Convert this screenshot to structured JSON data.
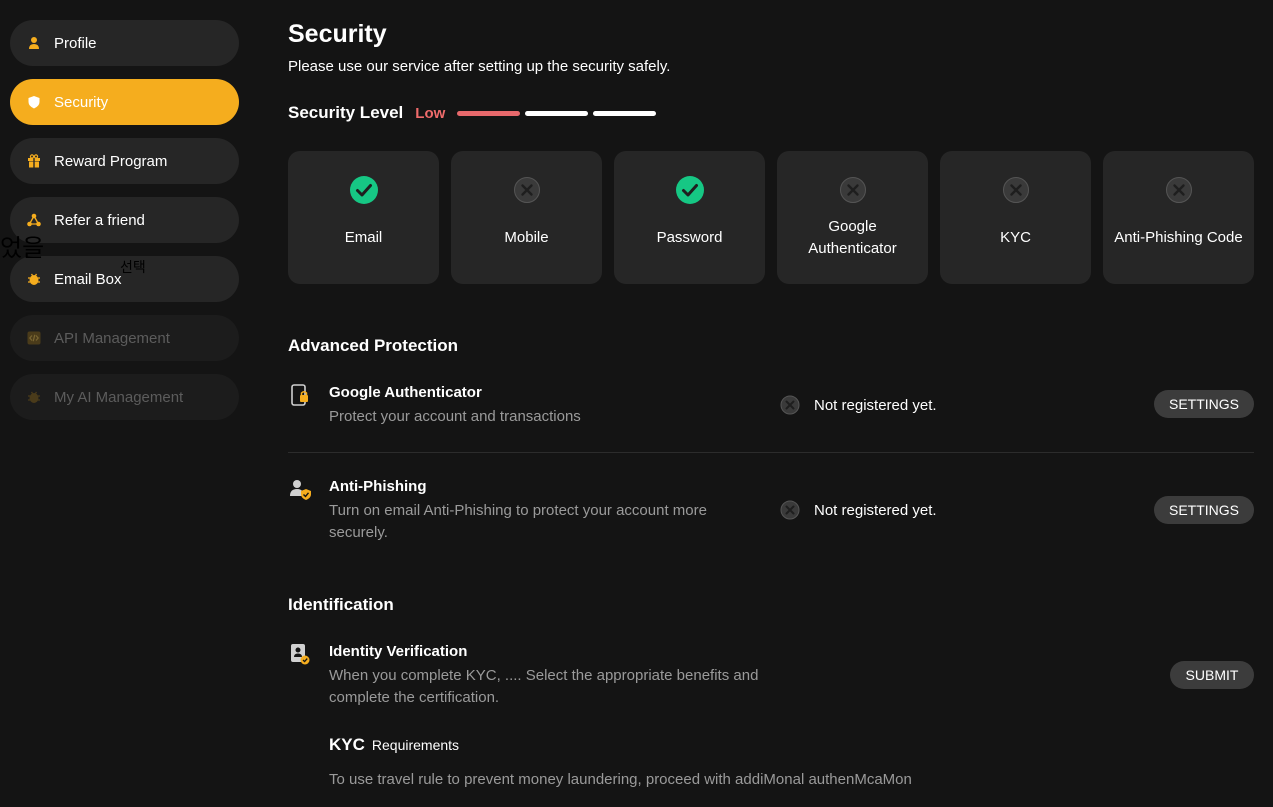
{
  "sidebar": {
    "items": [
      {
        "label": "Profile",
        "icon": "person-icon",
        "state": "normal"
      },
      {
        "label": "Security",
        "icon": "shield-icon",
        "state": "active"
      },
      {
        "label": "Reward Program",
        "icon": "gift-icon",
        "state": "normal"
      },
      {
        "label": "Refer a friend",
        "icon": "share-icon",
        "state": "normal"
      },
      {
        "label": "Email Box",
        "icon": "bug-icon",
        "state": "normal"
      },
      {
        "label": "API Management",
        "icon": "code-icon",
        "state": "disabled"
      },
      {
        "label": "My AI Management",
        "icon": "bug-icon",
        "state": "disabled"
      }
    ],
    "overlay_text_large": "었을",
    "overlay_text_small": "선택"
  },
  "header": {
    "title": "Security",
    "subtitle": "Please use our service after setting up the security safely."
  },
  "security_level": {
    "label": "Security Level",
    "value": "Low",
    "segments_filled": 1,
    "segments_total": 3
  },
  "cards": [
    {
      "label": "Email",
      "status": "done"
    },
    {
      "label": "Mobile",
      "status": "not-set"
    },
    {
      "label": "Password",
      "status": "done"
    },
    {
      "label": "Google Authenticator",
      "status": "not-set"
    },
    {
      "label": "KYC",
      "status": "not-set"
    },
    {
      "label": "Anti-Phishing Code",
      "status": "not-set"
    }
  ],
  "advanced": {
    "title": "Advanced Protection",
    "items": [
      {
        "title": "Google Authenticator",
        "description": "Protect your account and transactions",
        "status": "Not registered yet.",
        "button": "SETTINGS"
      },
      {
        "title": "Anti-Phishing",
        "description": "Turn on email Anti-Phishing to protect your account more securely.",
        "status": "Not registered yet.",
        "button": "SETTINGS"
      }
    ]
  },
  "identification": {
    "title": "Identification",
    "item": {
      "title": "Identity Verification",
      "description": "When you complete KYC, .... Select the appropriate benefits and complete the certification.",
      "button": "SUBMIT"
    },
    "kyc_label": "KYC",
    "requirements_label": "Requirements",
    "note": "To use travel rule to prevent money laundering, proceed with addiMonal authenMcaMon"
  },
  "colors": {
    "accent": "#f5ad1e",
    "success": "#16c784",
    "level_low": "#ef6b6b",
    "background": "#141414",
    "card": "#262626"
  }
}
